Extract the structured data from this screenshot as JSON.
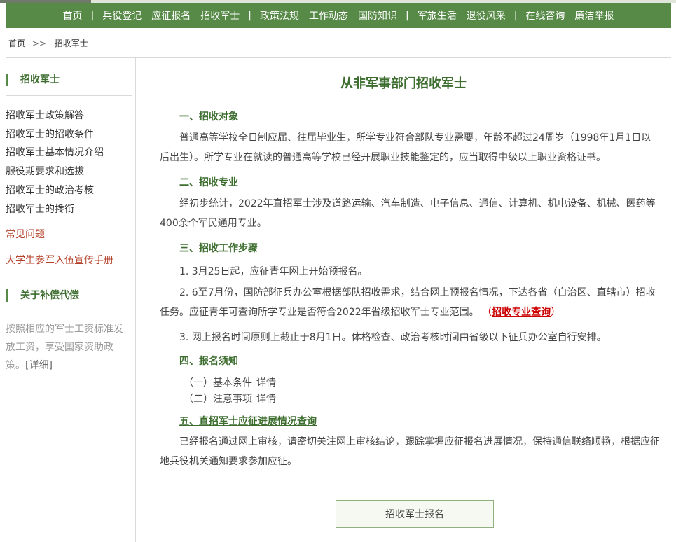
{
  "nav": {
    "items": [
      {
        "label": "首页"
      },
      {
        "sep": "|"
      },
      {
        "label": "兵役登记"
      },
      {
        "label": "应征报名"
      },
      {
        "label": "招收军士"
      },
      {
        "sep": "|"
      },
      {
        "label": "政策法规"
      },
      {
        "label": "工作动态"
      },
      {
        "label": "国防知识"
      },
      {
        "sep": "|"
      },
      {
        "label": "军旅生活"
      },
      {
        "label": "退役风采"
      },
      {
        "sep": "|"
      },
      {
        "label": "在线咨询"
      },
      {
        "label": "廉洁举报"
      }
    ]
  },
  "breadcrumb": {
    "home": "首页",
    "sep": ">>",
    "current": "招收军士"
  },
  "sidebar": {
    "heading1": "招收军士",
    "items": [
      "招收军士政策解答",
      "招收军士的招收条件",
      "招收军士基本情况介绍",
      "服役期要求和选拔",
      "招收军士的政治考核",
      "招收军士的搀衔"
    ],
    "faq": "常见问题",
    "handbook": "大学生参军入伍宣传手册",
    "heading2": "关于补偿代偿",
    "note": "按照相应的军士工资标准发放工资，享受国家资助政策。",
    "more": "[详细]"
  },
  "main": {
    "title": "从非军事部门招收军士",
    "s1_head": "一、招收对象",
    "s1_text": "普通高等学校全日制应届、往届毕业生，所学专业符合部队专业需要，年龄不超过24周岁（1998年1月1日以后出生）。所学专业在就读的普通高等学校已经开展职业技能鉴定的，应当取得中级以上职业资格证书。",
    "s2_head": "二、招收专业",
    "s2_text": "经初步统计，2022年直招军士涉及道路运输、汽车制造、电子信息、通信、计算机、机电设备、机械、医药等400余个军民通用专业。",
    "s3_head": "三、招收工作步骤",
    "s3_item1": "1. 3月25日起，应征青年网上开始预报名。",
    "s3_item2": "2. 6至7月份，国防部征兵办公室根据部队招收需求，结合网上预报名情况，下达各省（自治区、直辖市）招收任务。应征青年可查询所学专业是否符合2022年省级招收军士专业范围。",
    "s3_item2_open": "（",
    "s3_item2_link": "招收专业查询",
    "s3_item2_close": "）",
    "s3_item3": "3. 网上报名时间原则上截止于8月1日。体格检查、政治考核时间由省级以下征兵办公室自行安排。",
    "s4_head": "四、报名须知",
    "s4_sub1": "（一）基本条件",
    "s4_sub1_link": "详情",
    "s4_sub2": "（二）注意事项",
    "s4_sub2_link": "详情",
    "s5_head": "五、直招军士应征进展情况查询",
    "s5_text": "已经报名通过网上审核，请密切关注网上审核结论，跟踪掌握应征报名进展情况，保持通信联络顺畅，根据应征地兵役机关通知要求参加应征。",
    "button": "招收军士报名"
  },
  "colors": {
    "brand": "#578a47",
    "heading": "#3d6e2f",
    "accent_red": "#c00"
  }
}
